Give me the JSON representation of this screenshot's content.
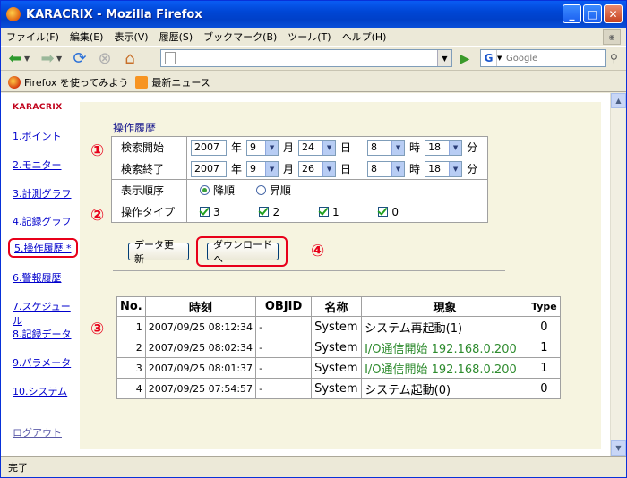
{
  "window": {
    "title": "KARACRIX - Mozilla Firefox"
  },
  "menu": [
    "ファイル(F)",
    "編集(E)",
    "表示(V)",
    "履歴(S)",
    "ブックマーク(B)",
    "ツール(T)",
    "ヘルプ(H)"
  ],
  "search": {
    "placeholder": "Google"
  },
  "bookmarks": [
    {
      "label": "Firefox を使ってみよう",
      "icon": "firefox-icon"
    },
    {
      "label": "最新ニュース",
      "icon": "rss-icon"
    }
  ],
  "sidebar": {
    "brand": "KARACRIX",
    "items": [
      {
        "label": "1.ポイント"
      },
      {
        "label": "2.モニター"
      },
      {
        "label": "3.計測グラフ"
      },
      {
        "label": "4.記録グラフ"
      },
      {
        "label": "5.操作履歴 *",
        "active": true
      },
      {
        "label": "6.警報履歴"
      },
      {
        "label": "7.スケジュール"
      },
      {
        "label": "8.記録データ"
      },
      {
        "label": "9.パラメータ"
      },
      {
        "label": "10.システム"
      }
    ],
    "logout": "ログアウト"
  },
  "page": {
    "title": "操作履歴",
    "markers": [
      "①",
      "②",
      "③",
      "④"
    ],
    "form": {
      "start_label": "検索開始",
      "end_label": "検索終了",
      "order_label": "表示順序",
      "type_label": "操作タイプ",
      "units": {
        "year": "年",
        "month": "月",
        "day": "日",
        "hour": "時",
        "minute": "分"
      },
      "start": {
        "year": "2007",
        "month": "9",
        "day": "24",
        "hour": "8",
        "minute": "18"
      },
      "end": {
        "year": "2007",
        "month": "9",
        "day": "26",
        "hour": "8",
        "minute": "18"
      },
      "order_options": [
        {
          "label": "降順",
          "checked": true
        },
        {
          "label": "昇順",
          "checked": false
        }
      ],
      "types": [
        {
          "label": "3",
          "checked": true
        },
        {
          "label": "2",
          "checked": true
        },
        {
          "label": "1",
          "checked": true
        },
        {
          "label": "0",
          "checked": true
        }
      ]
    },
    "buttons": {
      "refresh": "データ更新",
      "download": "ダウンロードへ"
    },
    "table": {
      "headers": [
        "No.",
        "時刻",
        "OBJID",
        "名称",
        "現象",
        "Type"
      ],
      "rows": [
        {
          "no": "1",
          "time": "2007/09/25 08:12:34",
          "objid": "-",
          "name": "System",
          "event": "システム再起動(1)",
          "type": "0",
          "color": "#000000"
        },
        {
          "no": "2",
          "time": "2007/09/25 08:02:34",
          "objid": "-",
          "name": "System",
          "event": "I/O通信開始 192.168.0.200",
          "type": "1",
          "color": "#2e8b2e"
        },
        {
          "no": "3",
          "time": "2007/09/25 08:01:37",
          "objid": "-",
          "name": "System",
          "event": "I/O通信開始 192.168.0.200",
          "type": "1",
          "color": "#2e8b2e"
        },
        {
          "no": "4",
          "time": "2007/09/25 07:54:57",
          "objid": "-",
          "name": "System",
          "event": "システム起動(0)",
          "type": "0",
          "color": "#000000"
        }
      ]
    }
  },
  "status": "完了"
}
